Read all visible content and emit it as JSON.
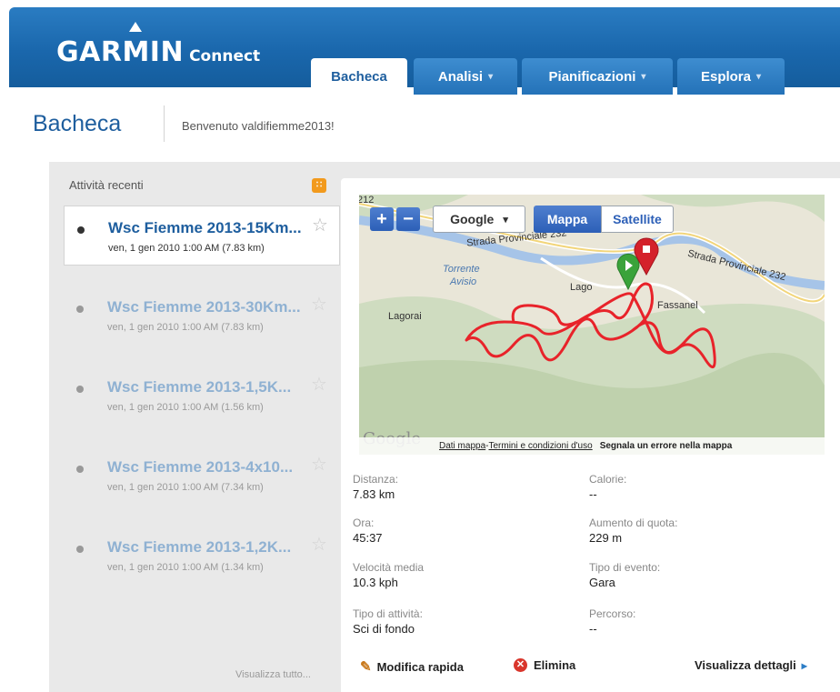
{
  "header": {
    "logo_main": "GARMIN",
    "logo_sub": "Connect",
    "tabs": [
      {
        "label": "Bacheca",
        "dropdown": ""
      },
      {
        "label": "Analisi",
        "dropdown": "▾"
      },
      {
        "label": "Pianificazioni",
        "dropdown": "▾"
      },
      {
        "label": "Esplora",
        "dropdown": "▾"
      }
    ]
  },
  "page": {
    "title": "Bacheca",
    "welcome": "Benvenuto valdifiemme2013!"
  },
  "recent": {
    "label": "Attività recenti",
    "rss_icon": "rss-icon",
    "view_all": "Visualizza tutto...",
    "items": [
      {
        "name": "Wsc Fiemme 2013-15Km...",
        "meta": "ven, 1 gen 2010 1:00 AM (7.83 km)"
      },
      {
        "name": "Wsc Fiemme 2013-30Km...",
        "meta": "ven, 1 gen 2010 1:00 AM (7.83 km)"
      },
      {
        "name": "Wsc Fiemme 2013-1,5K...",
        "meta": "ven, 1 gen 2010 1:00 AM (1.56 km)"
      },
      {
        "name": "Wsc Fiemme 2013-4x10...",
        "meta": "ven, 1 gen 2010 1:00 AM (7.34 km)"
      },
      {
        "name": "Wsc Fiemme 2013-1,2K...",
        "meta": "ven, 1 gen 2010 1:00 AM (1.34 km)"
      }
    ]
  },
  "map": {
    "zoom_in": "+",
    "zoom_out": "−",
    "provider": "Google",
    "provider_arrow": "▾",
    "type_map": "Mappa",
    "type_satellite": "Satellite",
    "labels": {
      "road_top": "212",
      "road1": "Strada Provinciale 232",
      "road2": "Strada Provinciale 232",
      "torrente1": "Torrente",
      "torrente2": "Avisio",
      "lago": "Lago",
      "fassane": "Fassanel",
      "lagorai": "Lagorai"
    },
    "watermark": "Google",
    "footer": {
      "dati": "Dati mappa",
      "sep": " - ",
      "termini": "Termini e condizioni d'uso",
      "segnala": "Segnala un errore nella mappa"
    },
    "colors": {
      "route": "#e8232a",
      "start": "#3aa33a",
      "end": "#d4212b",
      "river": "#a6c4e8",
      "road": "#ffffff"
    }
  },
  "stats": {
    "left": [
      {
        "label": "Distanza:",
        "value": "7.83 km"
      },
      {
        "label": "Ora:",
        "value": "45:37"
      },
      {
        "label": "Velocità media",
        "value": "10.3 kph"
      },
      {
        "label": "Tipo di attività:",
        "value": "Sci di fondo"
      }
    ],
    "right": [
      {
        "label": "Calorie:",
        "value": "--"
      },
      {
        "label": "Aumento di quota:",
        "value": "229 m"
      },
      {
        "label": "Tipo di evento:",
        "value": "Gara"
      },
      {
        "label": "Percorso:",
        "value": "--"
      }
    ]
  },
  "actions": {
    "edit": "Modifica rapida",
    "delete": "Elimina",
    "details": "Visualizza dettagli",
    "details_arrow": "▸"
  }
}
